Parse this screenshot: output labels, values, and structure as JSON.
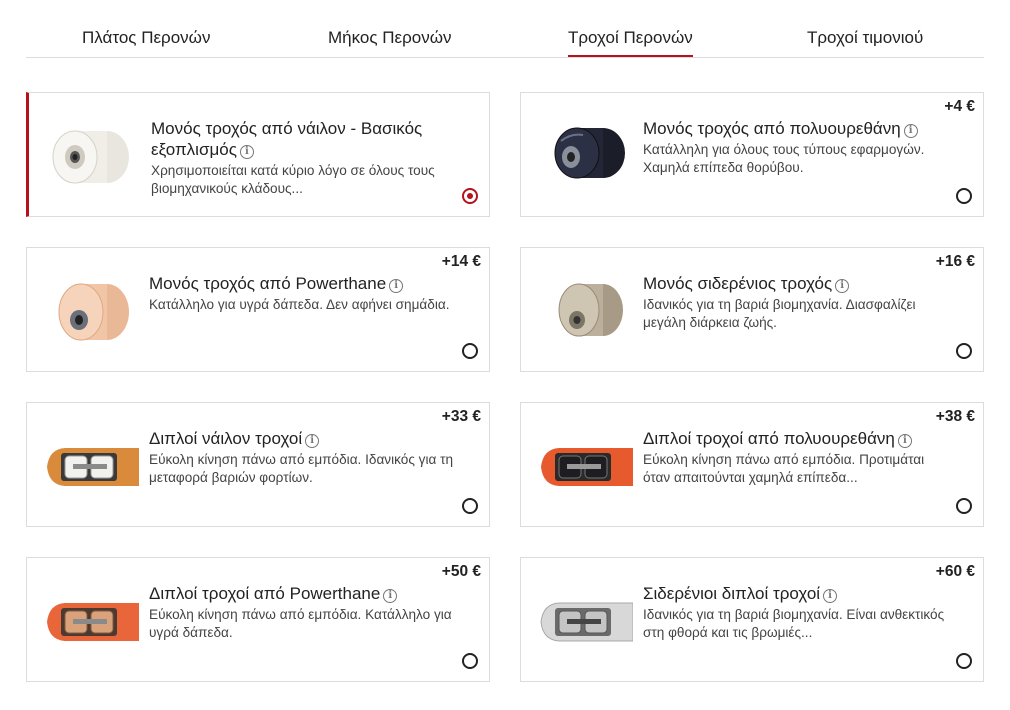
{
  "tabs": [
    {
      "label": "Πλάτος Περονών",
      "active": false
    },
    {
      "label": "Μήκος Περονών",
      "active": false
    },
    {
      "label": "Τροχοί Περονών",
      "active": true
    },
    {
      "label": "Τροχοί τιμονιού",
      "active": false
    }
  ],
  "options": [
    {
      "title": "Μονός τροχός από νάιλον - Βασικός εξοπλισμός",
      "description": "Χρησιμοποιείται κατά κύριο λόγο σε όλους τους βιομηχανικούς κλάδους...",
      "price": "",
      "selected": true,
      "image": "white-nylon-roller"
    },
    {
      "title": "Μονός τροχός από πολυουρεθάνη",
      "description": "Κατάλληλη για όλους τους τύπους εφαρμογών. Χαμηλά επίπεδα θορύβου.",
      "price": "+4 €",
      "selected": false,
      "image": "black-polyurethane-roller"
    },
    {
      "title": "Μονός τροχός από Powerthane",
      "description": "Κατάλληλο για υγρά δάπεδα. Δεν αφήνει σημάδια.",
      "price": "+14 €",
      "selected": false,
      "image": "orange-powerthane-roller"
    },
    {
      "title": "Μονός σιδερένιος τροχός",
      "description": "Ιδανικός για τη βαριά βιομηχανία. Διασφαλίζει μεγάλη διάρκεια ζωής.",
      "price": "+16 €",
      "selected": false,
      "image": "steel-roller"
    },
    {
      "title": "Διπλοί νάιλον τροχοί",
      "description": "Εύκολη κίνηση πάνω από εμπόδια. Ιδανικός για τη μεταφορά βαριών φορτίων.",
      "price": "+33 €",
      "selected": false,
      "image": "tandem-nylon-fork"
    },
    {
      "title": "Διπλοί τροχοί από πολυουρεθάνη",
      "description": "Εύκολη κίνηση πάνω από εμπόδια. Προτιμάται όταν απαιτούνται χαμηλά επίπεδα...",
      "price": "+38 €",
      "selected": false,
      "image": "tandem-polyurethane-fork"
    },
    {
      "title": "Διπλοί τροχοί από Powerthane",
      "description": "Εύκολη κίνηση πάνω από εμπόδια. Κατάλληλο για υγρά δάπεδα.",
      "price": "+50 €",
      "selected": false,
      "image": "tandem-powerthane-fork"
    },
    {
      "title": "Σιδερένιοι διπλοί τροχοί",
      "description": "Ιδανικός για τη βαριά βιομηχανία. Είναι ανθεκτικός στη φθορά και τις βρωμιές...",
      "price": "+60 €",
      "selected": false,
      "image": "tandem-steel-fork"
    }
  ],
  "info_icon_glyph": "i",
  "colors": {
    "accent": "#b5121b",
    "border": "#dcdcdc",
    "text": "#222222",
    "muted": "#444444"
  }
}
